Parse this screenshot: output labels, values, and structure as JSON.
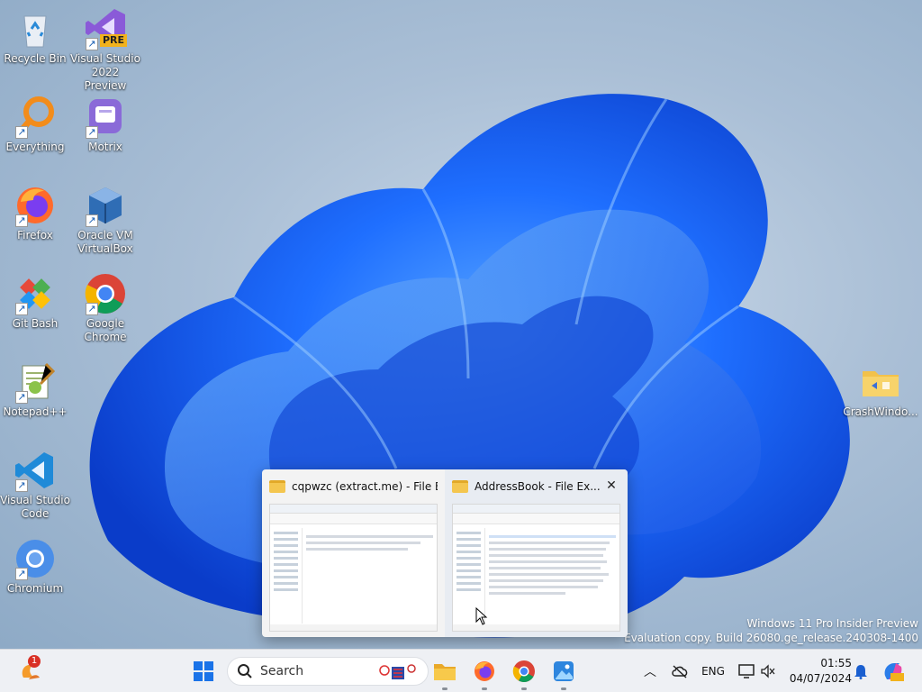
{
  "desktop_icons": [
    {
      "label": "Recycle Bin",
      "icon": "recycle-bin-icon"
    },
    {
      "label": "Visual Studio 2022 Preview",
      "icon": "visual-studio-preview-icon",
      "badge": "PRE"
    },
    {
      "label": "Everything",
      "icon": "everything-search-icon"
    },
    {
      "label": "Motrix",
      "icon": "motrix-icon"
    },
    {
      "label": "Firefox",
      "icon": "firefox-icon"
    },
    {
      "label": "Oracle VM VirtualBox",
      "icon": "virtualbox-icon"
    },
    {
      "label": "Git Bash",
      "icon": "git-bash-icon"
    },
    {
      "label": "Google Chrome",
      "icon": "chrome-icon"
    },
    {
      "label": "Notepad++",
      "icon": "notepadpp-icon"
    },
    {
      "label": "Visual Studio Code",
      "icon": "vscode-icon"
    },
    {
      "label": "Chromium",
      "icon": "chromium-icon"
    },
    {
      "label": "CrashWindo...",
      "icon": "folder-icon"
    }
  ],
  "task_view": {
    "windows": [
      {
        "title": "cqpwzc (extract.me) - File Ex...",
        "icon": "folder-icon"
      },
      {
        "title": "AddressBook - File Ex...",
        "icon": "folder-icon",
        "close_label": "✕"
      }
    ]
  },
  "watermark": {
    "line1": "Windows 11 Pro Insider Preview",
    "line2": "Evaluation copy. Build 26080.ge_release.240308-1400"
  },
  "taskbar": {
    "notification_badge": "1",
    "search_placeholder": "Search",
    "tray_language": "ENG",
    "time": "01:55",
    "date": "04/07/2024"
  }
}
